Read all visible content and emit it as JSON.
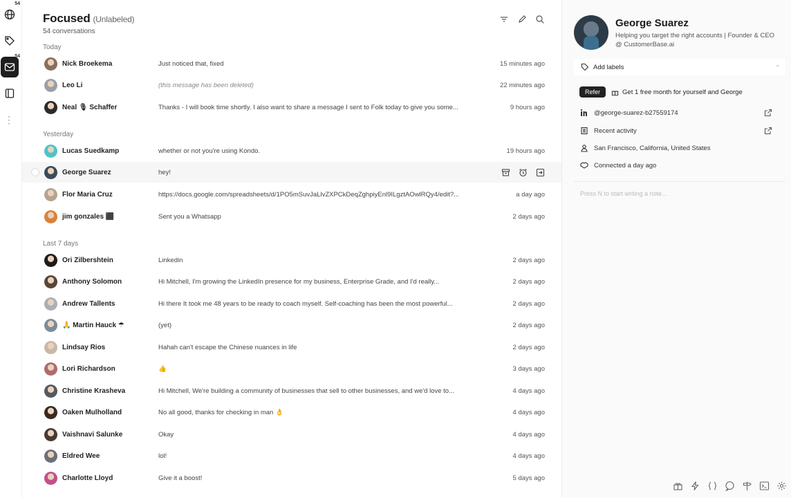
{
  "rail": {
    "badge_top": "54",
    "badge_inbox": "54"
  },
  "header": {
    "title": "Focused",
    "filter_label": "(Unlabeled)",
    "count": "54 conversations"
  },
  "groups": {
    "today": "Today",
    "yesterday": "Yesterday",
    "last7": "Last 7 days"
  },
  "rows": [
    {
      "name": "Nick Broekema",
      "msg": "Just noticed that, fixed",
      "time": "15 minutes ago",
      "color": "#8a6f5a"
    },
    {
      "name": "Leo Li",
      "msg": "(this message has been deleted)",
      "time": "22 minutes ago",
      "color": "#9aa0a6"
    },
    {
      "name": "Neal 🎙 Schaffer",
      "msg": "Thanks - I will book time shortly. I also want to share a message I sent to Folk today to give you some...",
      "time": "9 hours ago",
      "color": "#2b2b2b"
    },
    {
      "name": "Lucas Suedkamp",
      "msg": "whether or not you're using Kondo.",
      "time": "19 hours ago",
      "color": "#4fc3c8"
    },
    {
      "name": "George Suarez",
      "msg": "hey!",
      "time": "",
      "color": "#3b4b58"
    },
    {
      "name": "Flor Maria Cruz",
      "msg": "https://docs.google.com/spreadsheets/d/1PO5mSuvJaLlvZXPCkDeqZghpiyEnl9ILgztAOwlRQy4/edit?...",
      "time": "a day ago",
      "color": "#b5a48e"
    },
    {
      "name": "jim gonzales ⬛",
      "msg": "Sent you a Whatsapp",
      "time": "2 days ago",
      "color": "#d9823a"
    },
    {
      "name": "Ori Zilbershtein",
      "msg": "Linkedin",
      "time": "2 days ago",
      "color": "#1c1c1c"
    },
    {
      "name": "Anthony Solomon",
      "msg": "Hi Mitchell, I'm growing the LinkedIn presence for my business, Enterprise Grade, and I'd really...",
      "time": "2 days ago",
      "color": "#5a4636"
    },
    {
      "name": "Andrew Tallents",
      "msg": "Hi there It took me 48 years to be ready to coach myself. Self-coaching has been the most powerful...",
      "time": "2 days ago",
      "color": "#a8b0b8"
    },
    {
      "name": "🙏 Martin Hauck ☂",
      "msg": "(yet)",
      "time": "2 days ago",
      "color": "#7c8c9a"
    },
    {
      "name": "Lindsay Rios",
      "msg": "Hahah can't escape the Chinese nuances in life",
      "time": "2 days ago",
      "color": "#c9b8a8"
    },
    {
      "name": "Lori Richardson",
      "msg": "👍",
      "time": "3 days ago",
      "color": "#b06a6a"
    },
    {
      "name": "Christine Krasheva",
      "msg": "Hi Mitchell, We're building a community of businesses that sell to other businesses, and we'd love to...",
      "time": "4 days ago",
      "color": "#555a60"
    },
    {
      "name": "Oaken Mulholland",
      "msg": "No all good, thanks for checking in man 👌",
      "time": "4 days ago",
      "color": "#3a2a20"
    },
    {
      "name": "Vaishnavi Salunke",
      "msg": "Okay",
      "time": "4 days ago",
      "color": "#4a3a34"
    },
    {
      "name": "Eldred Wee",
      "msg": "lol!",
      "time": "4 days ago",
      "color": "#6c7078"
    },
    {
      "name": "Charlotte Lloyd",
      "msg": "Give it a boost!",
      "time": "5 days ago",
      "color": "#c2508a"
    }
  ],
  "panel": {
    "name": "George Suarez",
    "headline": "Helping you target the right accounts | Founder & CEO @ CustomerBase.ai",
    "add_labels": "Add labels",
    "refer_btn": "Refer",
    "refer_text": "Get 1 free month for yourself and George",
    "linkedin": "@george-suarez-b27559174",
    "recent_activity": "Recent activity",
    "location": "San Francisco, California, United States",
    "connected": "Connected a day ago",
    "note_placeholder": "Press N to start writing a note..."
  }
}
